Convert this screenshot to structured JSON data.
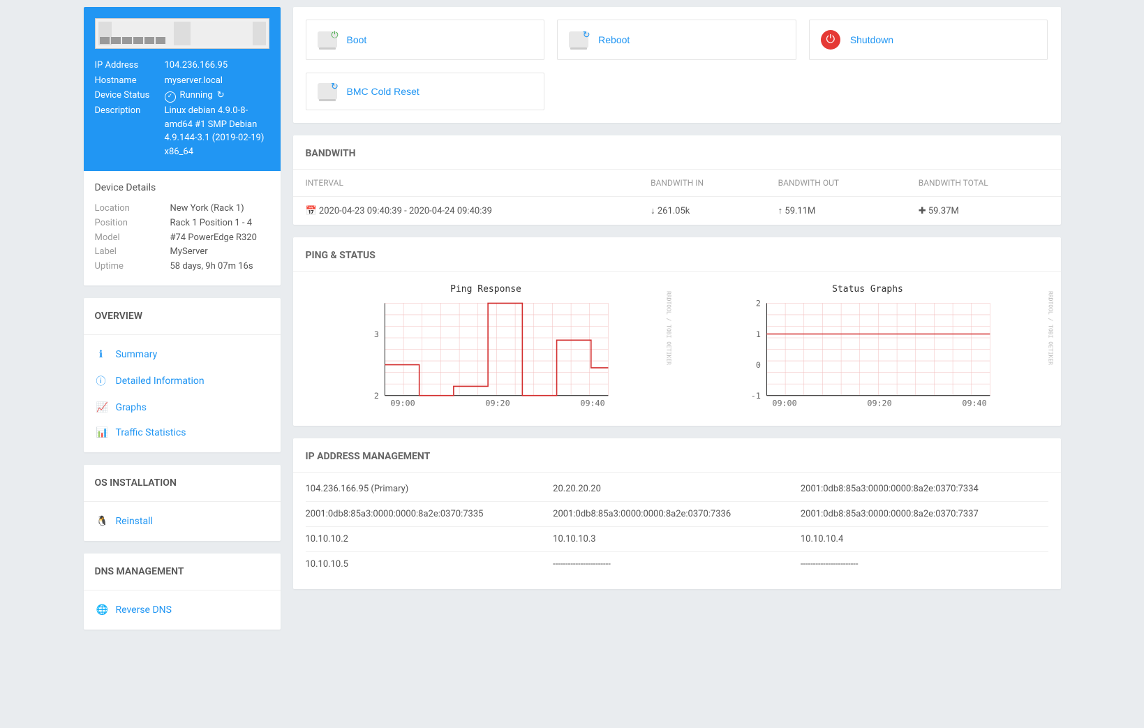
{
  "header": {
    "ip_label": "IP Address",
    "ip_value": "104.236.166.95",
    "hostname_label": "Hostname",
    "hostname_value": "myserver.local",
    "status_label": "Device Status",
    "status_value": "Running",
    "description_label": "Description",
    "description_value": "Linux debian 4.9.0-8-amd64 #1 SMP Debian 4.9.144-3.1 (2019-02-19) x86_64"
  },
  "details": {
    "title": "Device Details",
    "location_label": "Location",
    "location_value": "New York (Rack 1)",
    "position_label": "Position",
    "position_value": "Rack 1 Position 1 - 4",
    "model_label": "Model",
    "model_value": "#74 PowerEdge R320",
    "label_label": "Label",
    "label_value": "MyServer",
    "uptime_label": "Uptime",
    "uptime_value": "58 days, 9h 07m 16s"
  },
  "overview": {
    "title": "OVERVIEW",
    "summary": "Summary",
    "detailed": "Detailed Information",
    "graphs": "Graphs",
    "traffic": "Traffic Statistics"
  },
  "os": {
    "title": "OS INSTALLATION",
    "reinstall": "Reinstall"
  },
  "dns": {
    "title": "DNS MANAGEMENT",
    "reverse": "Reverse DNS"
  },
  "actions": {
    "boot": "Boot",
    "reboot": "Reboot",
    "shutdown": "Shutdown",
    "bmc": "BMC Cold Reset"
  },
  "bandwidth": {
    "title": "BANDWITH",
    "col_interval": "INTERVAL",
    "col_in": "BANDWITH IN",
    "col_out": "BANDWITH OUT",
    "col_total": "BANDWITH TOTAL",
    "interval": "2020-04-23 09:40:39 - 2020-04-24 09:40:39",
    "in": "261.05k",
    "out": "59.11M",
    "total": "59.37M"
  },
  "ping": {
    "title": "PING & STATUS",
    "chart1_title": "Ping Response",
    "chart2_title": "Status Graphs",
    "side_label": "RRDTOOL / TOBI OETIKER"
  },
  "ipam": {
    "title": "IP ADDRESS MANAGEMENT",
    "rows": [
      [
        "104.236.166.95 (Primary)",
        "20.20.20.20",
        "2001:0db8:85a3:0000:0000:8a2e:0370:7334"
      ],
      [
        "2001:0db8:85a3:0000:0000:8a2e:0370:7335",
        "2001:0db8:85a3:0000:0000:8a2e:0370:7336",
        "2001:0db8:85a3:0000:0000:8a2e:0370:7337"
      ],
      [
        "10.10.10.2",
        "10.10.10.3",
        "10.10.10.4"
      ],
      [
        "10.10.10.5",
        "-----------------------",
        "-----------------------"
      ]
    ]
  },
  "chart_data": [
    {
      "type": "line",
      "title": "Ping Response",
      "xlabel": "",
      "ylabel": "",
      "ylim": [
        2,
        3.5
      ],
      "x_ticks": [
        "09:00",
        "09:20",
        "09:40"
      ],
      "y_ticks": [
        2,
        3
      ],
      "series": [
        {
          "name": "ping",
          "x": [
            0,
            1,
            2,
            3,
            4,
            5,
            6,
            7,
            8,
            9,
            10,
            11,
            12,
            13
          ],
          "values": [
            2.5,
            2.5,
            2.0,
            2.0,
            2.15,
            2.15,
            3.5,
            3.5,
            2.0,
            2.0,
            2.9,
            2.9,
            2.45,
            2.45
          ]
        }
      ]
    },
    {
      "type": "line",
      "title": "Status Graphs",
      "xlabel": "",
      "ylabel": "",
      "ylim": [
        -1,
        2
      ],
      "x_ticks": [
        "09:00",
        "09:20",
        "09:40"
      ],
      "y_ticks": [
        -1,
        0,
        1,
        2
      ],
      "series": [
        {
          "name": "status",
          "x": [
            0,
            1,
            2,
            3,
            4,
            5,
            6,
            7,
            8,
            9,
            10,
            11,
            12,
            13
          ],
          "values": [
            1,
            1,
            1,
            1,
            1,
            1,
            1,
            1,
            1,
            1,
            1,
            1,
            1,
            1
          ]
        }
      ]
    }
  ]
}
